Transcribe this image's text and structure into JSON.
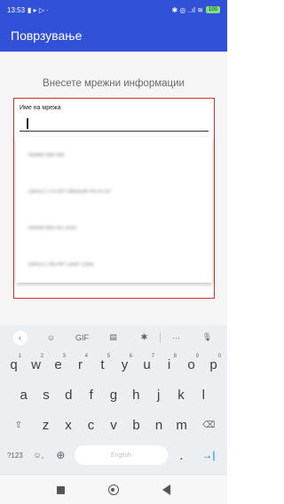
{
  "status_bar": {
    "time": "13:53",
    "left_icons": "▮ ▸ ▷ ·",
    "right_icons": "✱ ◎ ..ıl ≋",
    "battery": "100"
  },
  "app_bar": {
    "title": "Поврзување"
  },
  "main": {
    "heading": "Внесете мрежни информации",
    "network_field": {
      "label": "Име на мрежа",
      "value": ""
    },
    "suggestions": [
      {
        "label": "Mobile Wifi Net"
      },
      {
        "label": "DIRECT-F5-HP OfficeJet Pro 8710"
      },
      {
        "label": "HomeFibre 5G 2020"
      },
      {
        "label": "DIRECT-65-HP Laser 135w"
      }
    ]
  },
  "keyboard": {
    "toolbar": {
      "back": "‹",
      "sticker": "☺",
      "gif": "GIF",
      "clipboard": "▤",
      "settings": "✱",
      "more": "···",
      "mic": "🎙"
    },
    "row1": [
      {
        "key": "q",
        "hint": "1"
      },
      {
        "key": "w",
        "hint": "2"
      },
      {
        "key": "e",
        "hint": "3"
      },
      {
        "key": "r",
        "hint": "4"
      },
      {
        "key": "t",
        "hint": "5"
      },
      {
        "key": "y",
        "hint": "6"
      },
      {
        "key": "u",
        "hint": "7"
      },
      {
        "key": "i",
        "hint": "8"
      },
      {
        "key": "o",
        "hint": "9"
      },
      {
        "key": "p",
        "hint": "0"
      }
    ],
    "row2": [
      "a",
      "s",
      "d",
      "f",
      "g",
      "h",
      "j",
      "k",
      "l"
    ],
    "row3": [
      "z",
      "x",
      "c",
      "v",
      "b",
      "n",
      "m"
    ],
    "shift": "⇧",
    "backspace": "⌫",
    "symbols": "?123",
    "emoji": "☺,",
    "globe": "⊕",
    "space": "English",
    "period": ".",
    "enter": "→|"
  },
  "nav_bar": {
    "back": "◀"
  }
}
